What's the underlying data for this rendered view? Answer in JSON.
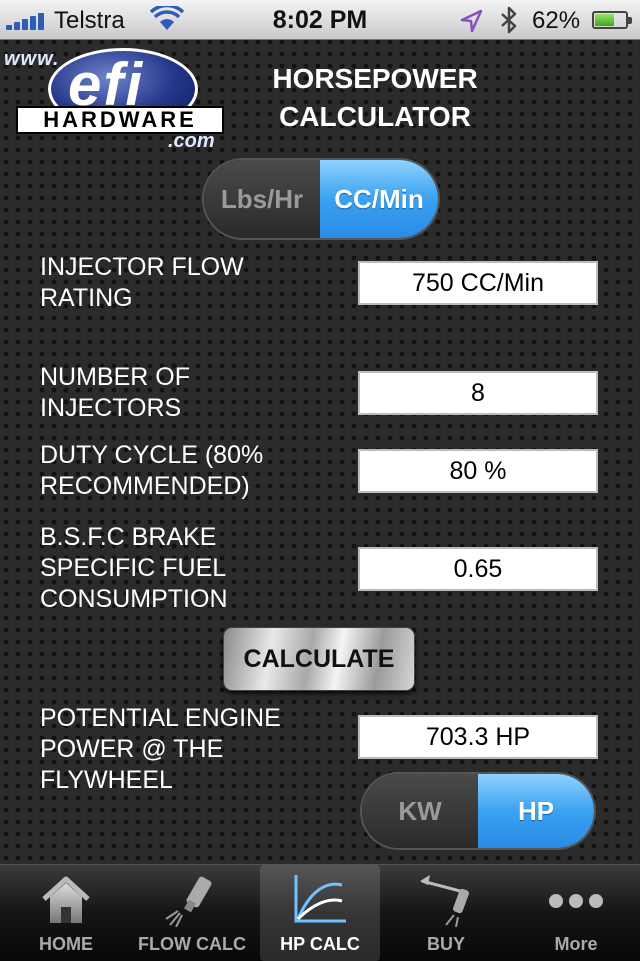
{
  "status": {
    "carrier": "Telstra",
    "time": "8:02 PM",
    "battery": "62%",
    "battery_level": 0.62,
    "location_icon": "location-arrow-icon",
    "bluetooth_icon": "bluetooth-icon"
  },
  "logo": {
    "www": "www.",
    "brand": "efi",
    "sub": "HARDWARE",
    "com": ".com"
  },
  "title": {
    "line1": "HORSEPOWER",
    "line2": "CALCULATOR"
  },
  "unit_toggle": {
    "left": "Lbs/Hr",
    "right": "CC/Min",
    "selected": "CC/Min"
  },
  "fields": {
    "flow": {
      "label1": "INJECTOR FLOW",
      "label2": "RATING",
      "value": "750 CC/Min"
    },
    "count": {
      "label1": "NUMBER OF",
      "label2": "INJECTORS",
      "value": "8"
    },
    "duty": {
      "label1": "DUTY CYCLE (80%",
      "label2": "RECOMMENDED)",
      "value": "80 %"
    },
    "bsfc": {
      "label1": "B.S.F.C BRAKE",
      "label2": "SPECIFIC FUEL",
      "label3": "CONSUMPTION",
      "value": "0.65"
    },
    "power": {
      "label1": "POTENTIAL ENGINE",
      "label2": "POWER @ THE",
      "label3": "FLYWHEEL",
      "value": "703.3 HP"
    }
  },
  "calculate_label": "CALCULATE",
  "output_toggle": {
    "left": "KW",
    "right": "HP",
    "selected": "HP"
  },
  "tabs": [
    {
      "label": "HOME",
      "icon": "home-icon"
    },
    {
      "label": "FLOW CALC",
      "icon": "injector-icon"
    },
    {
      "label": "HP CALC",
      "icon": "graph-icon",
      "active": true
    },
    {
      "label": "BUY",
      "icon": "buy-icon"
    },
    {
      "label": "More",
      "icon": "more-icon"
    }
  ],
  "colors": {
    "accent": "#3aa2f2",
    "background": "#2b2b2b"
  }
}
